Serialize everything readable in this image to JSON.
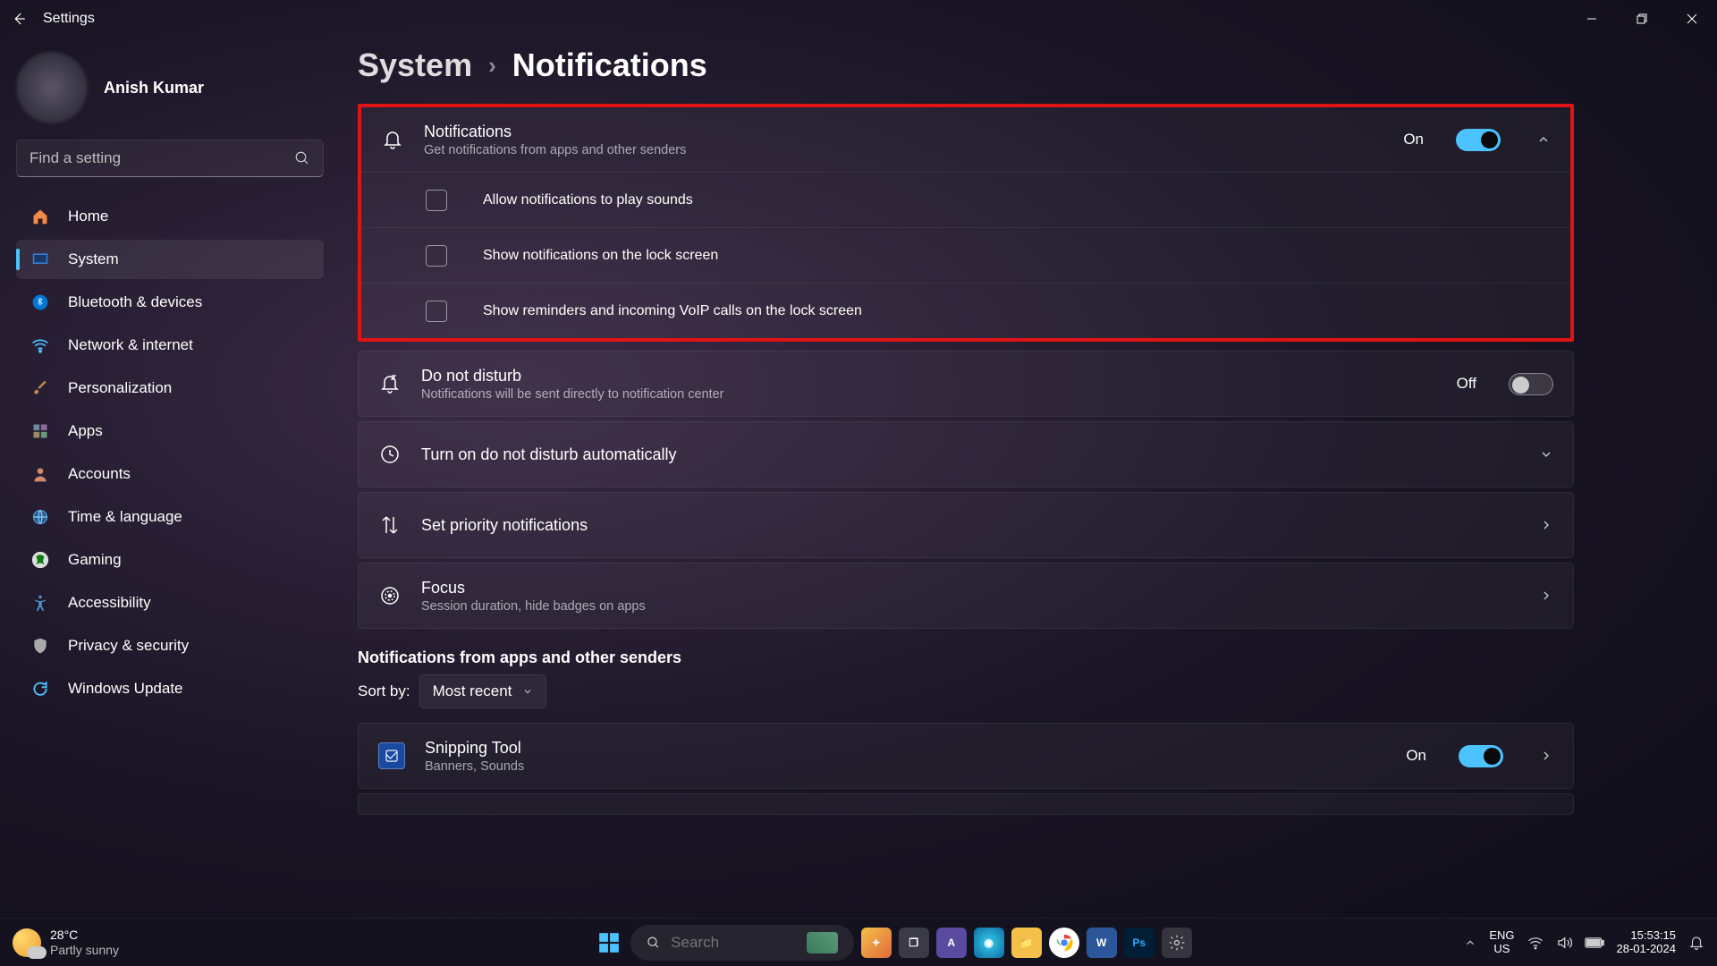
{
  "window": {
    "title": "Settings"
  },
  "user": {
    "name": "Anish Kumar"
  },
  "search": {
    "placeholder": "Find a setting"
  },
  "nav": {
    "items": [
      {
        "id": "home",
        "label": "Home"
      },
      {
        "id": "system",
        "label": "System",
        "selected": true
      },
      {
        "id": "bluetooth",
        "label": "Bluetooth & devices"
      },
      {
        "id": "network",
        "label": "Network & internet"
      },
      {
        "id": "personalization",
        "label": "Personalization"
      },
      {
        "id": "apps",
        "label": "Apps"
      },
      {
        "id": "accounts",
        "label": "Accounts"
      },
      {
        "id": "time",
        "label": "Time & language"
      },
      {
        "id": "gaming",
        "label": "Gaming"
      },
      {
        "id": "accessibility",
        "label": "Accessibility"
      },
      {
        "id": "privacy",
        "label": "Privacy & security"
      },
      {
        "id": "update",
        "label": "Windows Update"
      }
    ]
  },
  "breadcrumb": {
    "parent": "System",
    "current": "Notifications"
  },
  "notifications_card": {
    "title": "Notifications",
    "subtitle": "Get notifications from apps and other senders",
    "state_label": "On",
    "checkboxes": [
      "Allow notifications to play sounds",
      "Show notifications on the lock screen",
      "Show reminders and incoming VoIP calls on the lock screen"
    ]
  },
  "dnd_card": {
    "title": "Do not disturb",
    "subtitle": "Notifications will be sent directly to notification center",
    "state_label": "Off"
  },
  "auto_dnd": {
    "title": "Turn on do not disturb automatically"
  },
  "priority": {
    "title": "Set priority notifications"
  },
  "focus": {
    "title": "Focus",
    "subtitle": "Session duration, hide badges on apps"
  },
  "apps_section": {
    "header": "Notifications from apps and other senders",
    "sort_label": "Sort by:",
    "sort_value": "Most recent",
    "items": [
      {
        "name": "Snipping Tool",
        "detail": "Banners, Sounds",
        "state_label": "On"
      }
    ]
  },
  "taskbar": {
    "weather_temp": "28°C",
    "weather_desc": "Partly sunny",
    "search_placeholder": "Search",
    "lang_top": "ENG",
    "lang_bottom": "US",
    "time": "15:53:15",
    "date": "28-01-2024"
  }
}
